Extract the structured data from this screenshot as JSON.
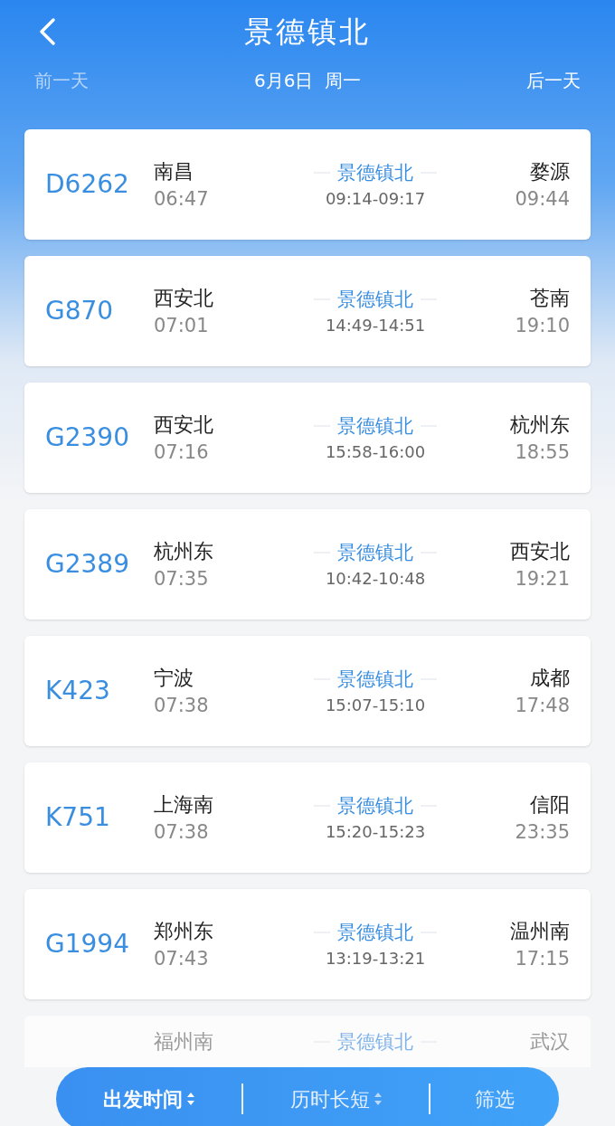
{
  "header": {
    "title": "景德镇北"
  },
  "date_nav": {
    "prev": {
      "label": "前一天",
      "disabled": true
    },
    "date": "6月6日  周一",
    "next": {
      "label": "后一天",
      "disabled": false
    }
  },
  "trains": [
    {
      "number": "D6262",
      "from": "南昌",
      "depart": "06:47",
      "via": "景德镇北",
      "via_time": "09:14-09:17",
      "to": "婺源",
      "arrive": "09:44",
      "faded": false
    },
    {
      "number": "G870",
      "from": "西安北",
      "depart": "07:01",
      "via": "景德镇北",
      "via_time": "14:49-14:51",
      "to": "苍南",
      "arrive": "19:10",
      "faded": false
    },
    {
      "number": "G2390",
      "from": "西安北",
      "depart": "07:16",
      "via": "景德镇北",
      "via_time": "15:58-16:00",
      "to": "杭州东",
      "arrive": "18:55",
      "faded": false
    },
    {
      "number": "G2389",
      "from": "杭州东",
      "depart": "07:35",
      "via": "景德镇北",
      "via_time": "10:42-10:48",
      "to": "西安北",
      "arrive": "19:21",
      "faded": false
    },
    {
      "number": "K423",
      "from": "宁波",
      "depart": "07:38",
      "via": "景德镇北",
      "via_time": "15:07-15:10",
      "to": "成都",
      "arrive": "17:48",
      "faded": false
    },
    {
      "number": "K751",
      "from": "上海南",
      "depart": "07:38",
      "via": "景德镇北",
      "via_time": "15:20-15:23",
      "to": "信阳",
      "arrive": "23:35",
      "faded": false
    },
    {
      "number": "G1994",
      "from": "郑州东",
      "depart": "07:43",
      "via": "景德镇北",
      "via_time": "13:19-13:21",
      "to": "温州南",
      "arrive": "17:15",
      "faded": false
    },
    {
      "from": "福州南",
      "via": "景德镇北",
      "to": "武汉",
      "faded": true
    }
  ],
  "bottom_bar": {
    "sorts": [
      {
        "label": "出发时间",
        "selected": true
      },
      {
        "label": "历时长短",
        "selected": false
      }
    ],
    "filter": "筛选"
  }
}
